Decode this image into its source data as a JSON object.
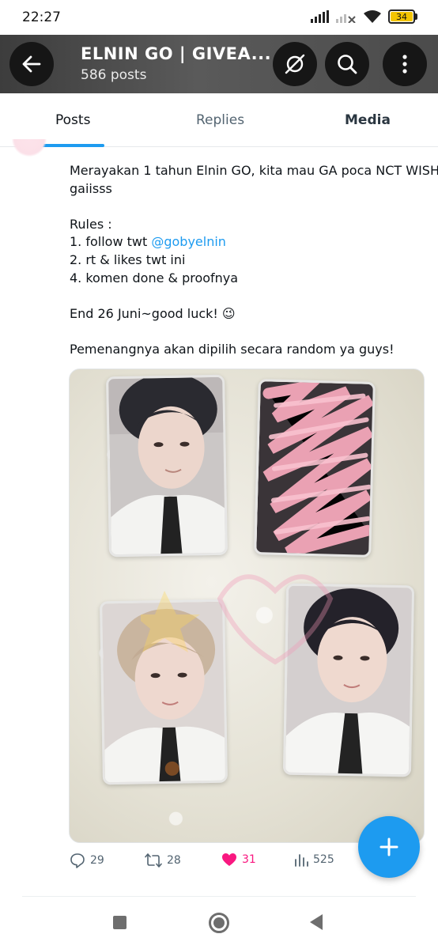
{
  "status_bar": {
    "time": "22:27",
    "battery": "34"
  },
  "header": {
    "title": "ELNIN GO | GIVEA...",
    "subtitle": "586 posts",
    "background_color": "#4a4a4a"
  },
  "tabs": [
    {
      "label": "Posts",
      "active": true
    },
    {
      "label": "Replies",
      "active": false
    },
    {
      "label": "Media",
      "active": false
    }
  ],
  "post": {
    "text": {
      "line1": "Merayakan 1 tahun Elnin GO, kita mau GA poca NCT WISH",
      "line2": "gaiisss",
      "rules_title": "Rules :",
      "rule1_prefix": "1. follow twt ",
      "rule1_mention": "@gobyelnin",
      "rule2": "2. rt & likes twt ini",
      "rule3": "4. komen done & proofnya",
      "end": "End 26 Juni~good luck! 😉",
      "closing": "Pemenangnya akan dipilih secara random ya guys!"
    },
    "media_description_icon": "photocard-image",
    "actions": {
      "replies": "29",
      "reposts": "28",
      "likes": "31",
      "views": "525"
    }
  },
  "colors": {
    "accent": "#1d9bf0",
    "like": "#f91880",
    "muted": "#536471"
  },
  "icons": {
    "back": "arrow-left-icon",
    "grok": "grok-icon",
    "search": "search-icon",
    "more": "more-vertical-icon",
    "reply": "reply-icon",
    "repost": "repost-icon",
    "like": "heart-icon",
    "views": "views-icon",
    "compose": "plus-icon"
  }
}
